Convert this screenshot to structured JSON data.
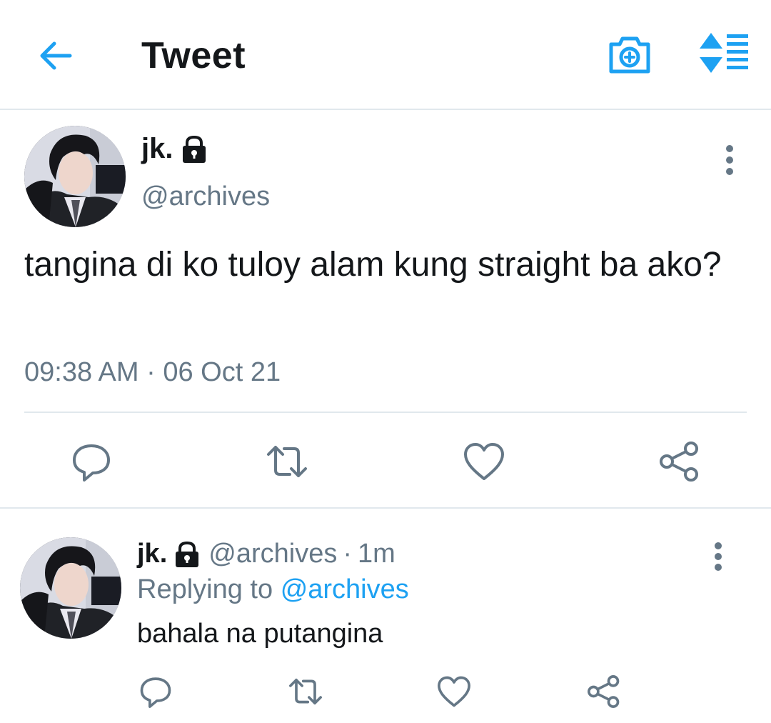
{
  "header": {
    "title": "Tweet",
    "icons": [
      "back-arrow-icon",
      "camera-plus-icon",
      "sort-timeline-icon"
    ],
    "accent_color": "#1da1f2"
  },
  "main_tweet": {
    "name": "jk.",
    "handle": "@archives",
    "protected": true,
    "text": "tangina di ko tuloy alam kung straight ba ako?",
    "timestamp": "09:38 AM · 06 Oct 21",
    "actions": [
      "reply-icon",
      "retweet-icon",
      "like-icon",
      "share-icon"
    ]
  },
  "reply_tweet": {
    "name": "jk.",
    "handle": "@archives",
    "dot": "·",
    "time": "1m",
    "replying_prefix": "Replying to",
    "replying_to": "@archives",
    "text": "bahala na putangina",
    "actions": [
      "reply-icon",
      "retweet-icon",
      "like-icon",
      "share-icon"
    ]
  }
}
